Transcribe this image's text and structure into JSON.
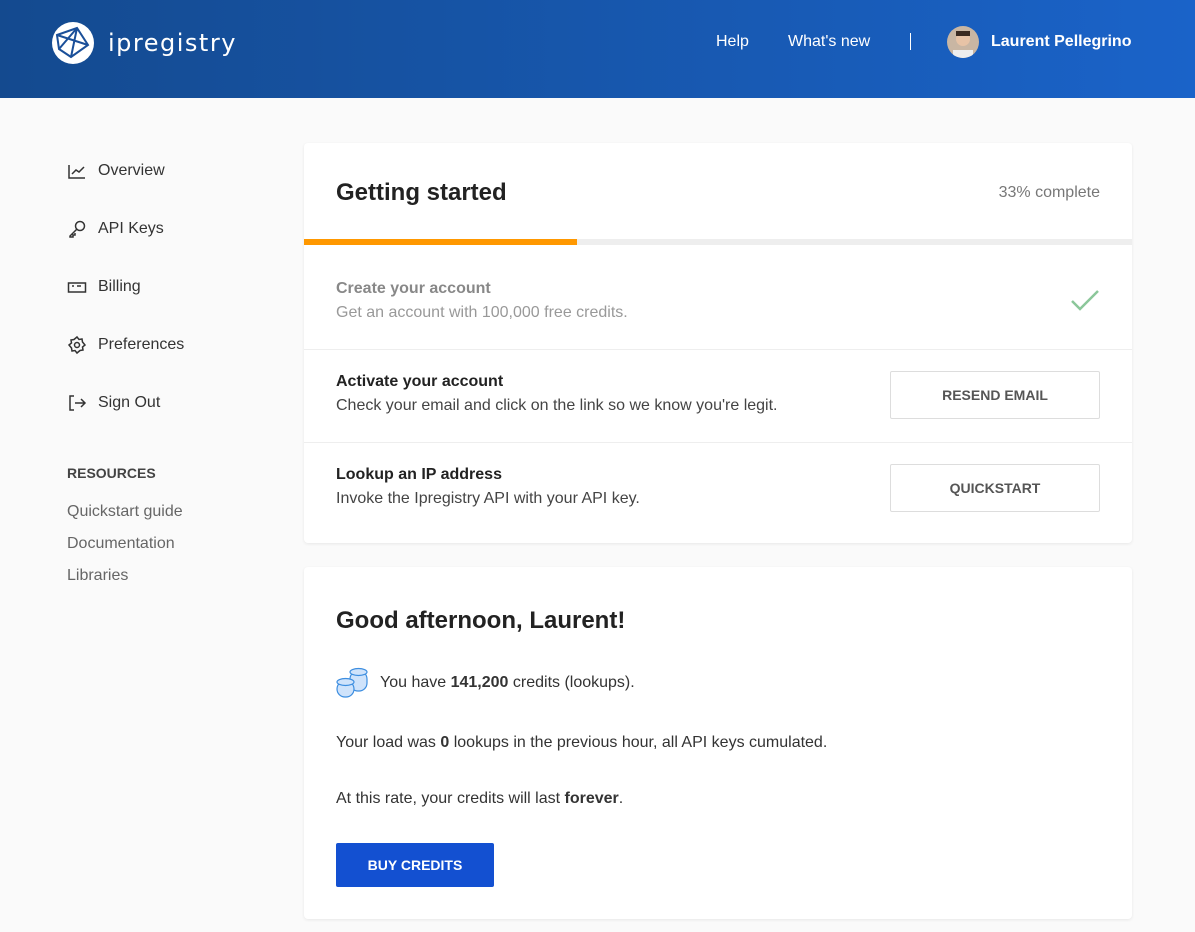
{
  "header": {
    "brand": "ipregistry",
    "nav": [
      "Help",
      "What's new"
    ],
    "user_name": "Laurent Pellegrino"
  },
  "sidebar": {
    "items": [
      {
        "label": "Overview",
        "icon": "chart-line-icon"
      },
      {
        "label": "API Keys",
        "icon": "key-icon"
      },
      {
        "label": "Billing",
        "icon": "money-bill-icon"
      },
      {
        "label": "Preferences",
        "icon": "gear-icon"
      },
      {
        "label": "Sign Out",
        "icon": "sign-out-icon"
      }
    ],
    "resources_heading": "RESOURCES",
    "resources": [
      "Quickstart guide",
      "Documentation",
      "Libraries"
    ]
  },
  "getting_started": {
    "title": "Getting started",
    "progress_label": "33% complete",
    "progress": 33,
    "accent": "#ff9800",
    "steps": [
      {
        "title": "Create your account",
        "desc": "Get an account with 100,000 free credits.",
        "done": true
      },
      {
        "title": "Activate your account",
        "desc": "Check your email and click on the link so we know you're legit.",
        "button": "RESEND EMAIL"
      },
      {
        "title": "Lookup an IP address",
        "desc": "Invoke the Ipregistry API with your API key.",
        "button": "QUICKSTART"
      }
    ]
  },
  "welcome": {
    "title": "Good afternoon, Laurent!",
    "credits_pre": "You have ",
    "credits": "141,200",
    "credits_post": " credits (lookups).",
    "load_pre": "Your load was ",
    "load": "0",
    "load_post": " lookups in the previous hour, all API keys cumulated.",
    "rate_pre": "At this rate, your credits will last ",
    "rate": "forever",
    "rate_post": ".",
    "buy_label": "BUY CREDITS"
  }
}
